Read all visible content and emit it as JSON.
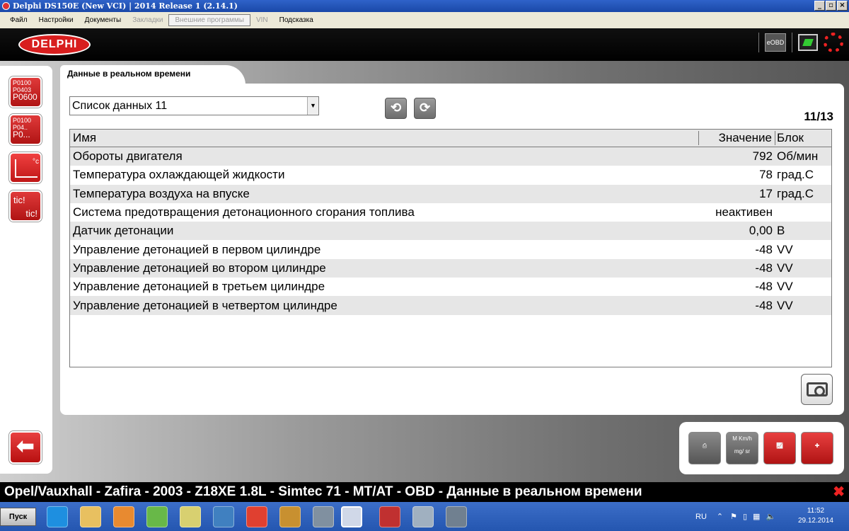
{
  "window": {
    "title": "Delphi DS150E (New VCI) | 2014 Release 1 (2.14.1)"
  },
  "menu": [
    "Файл",
    "Настройки",
    "Документы",
    "Закладки",
    "Внешние программы",
    "VIN",
    "Подсказка"
  ],
  "header": {
    "logo": "DELPHI",
    "eobd": "eOBD"
  },
  "sidebar": {
    "dtc_codes": [
      "P0100",
      "P0403",
      "P0600"
    ],
    "dtc_codes_2": [
      "P0100",
      "P04..",
      "P0..."
    ],
    "tic": "tic!"
  },
  "tab": {
    "label": "Данные в реальном времени"
  },
  "list_select": {
    "value": "Список данных 11"
  },
  "page_counter": "11/13",
  "table": {
    "headers": {
      "name": "Имя",
      "value": "Значение",
      "unit": "Блок"
    },
    "rows": [
      {
        "name": "Обороты двигателя",
        "value": "792",
        "unit": "Об/мин"
      },
      {
        "name": "Температура охлаждающей жидкости",
        "value": "78",
        "unit": "град.С"
      },
      {
        "name": "Температура воздуха на впуске",
        "value": "17",
        "unit": "град.С"
      },
      {
        "name": "Система предотвращения детонационного сгорания топлива",
        "value": "неактивен",
        "unit": ""
      },
      {
        "name": "Датчик детонации",
        "value": "0,00",
        "unit": "В"
      },
      {
        "name": "Управление детонацией в первом цилиндре",
        "value": "-48",
        "unit": "VV"
      },
      {
        "name": "Управление детонацией во втором цилиндре",
        "value": "-48",
        "unit": "VV"
      },
      {
        "name": "Управление детонацией в третьем цилиндре",
        "value": "-48",
        "unit": "VV"
      },
      {
        "name": "Управление детонацией в четвертом цилиндре",
        "value": "-48",
        "unit": "VV"
      }
    ]
  },
  "tools": {
    "units_label_top": "M Km/h",
    "units_label_bottom": "mg/ sr"
  },
  "status_bar": "Opel/Vauxhall - Zafira - 2003 - Z18XE 1.8L - Simtec 71 - MT/AT - OBD - Данные в реальном времени",
  "taskbar": {
    "start": "Пуск",
    "lang": "RU",
    "time": "11:52",
    "date": "29.12.2014"
  },
  "colors": {
    "accent_red": "#d81e1e",
    "taskbar_blue": "#2456b0"
  }
}
